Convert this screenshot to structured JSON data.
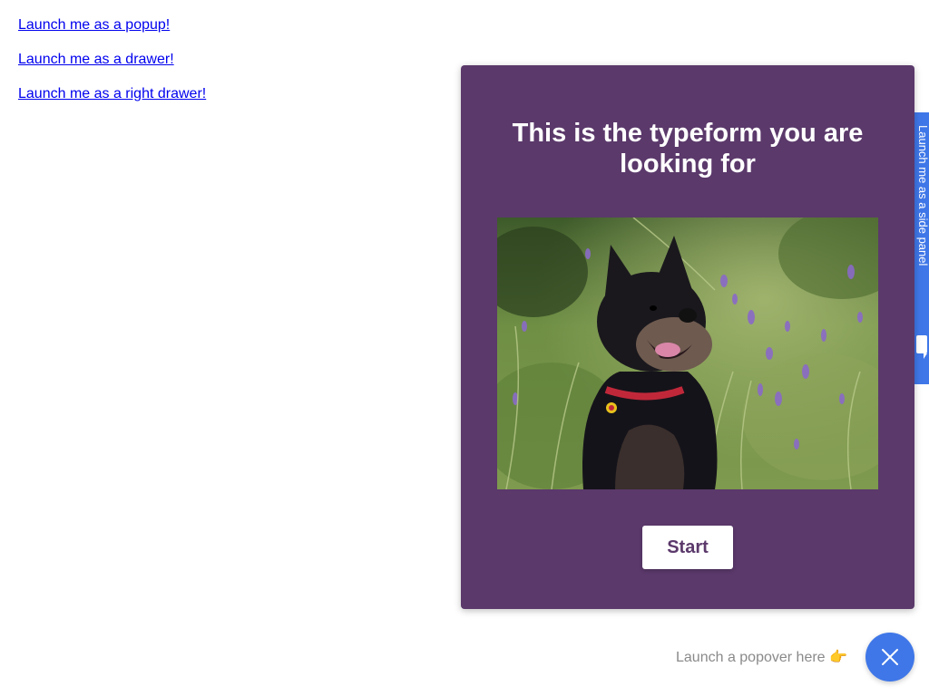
{
  "links": [
    {
      "label": "Launch me as a popup!"
    },
    {
      "label": "Launch me as a drawer!"
    },
    {
      "label": "Launch me as a right drawer!"
    }
  ],
  "side_tab": {
    "label": "Launch me as a side panel",
    "icon": "chat-bubble-icon",
    "color": "#3f77e8"
  },
  "popover": {
    "title": "This is the typeform you are looking for",
    "image": "dog-in-flowers-photo",
    "start_label": "Start",
    "background": "#5b396b"
  },
  "launcher": {
    "text": "Launch a popover here 👉",
    "close_icon": "close-icon",
    "color": "#3f77e8"
  }
}
